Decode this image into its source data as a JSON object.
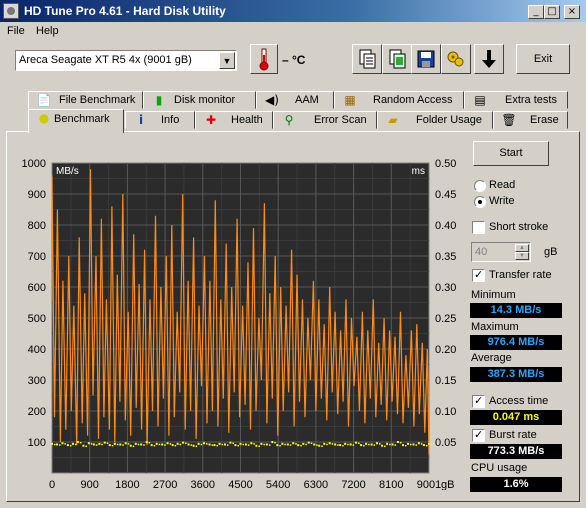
{
  "window": {
    "title": "HD Tune Pro 4.61 - Hard Disk Utility"
  },
  "menu": [
    {
      "label": "File"
    },
    {
      "label": "Help"
    }
  ],
  "toolbar": {
    "drive": "Areca   Seagate XT R5 4x (9001 gB)",
    "temperature": "– °C",
    "exit_label": "Exit",
    "tools": [
      "copy-text-icon",
      "copy-screenshot-icon",
      "save-icon",
      "options-icon",
      "download-icon"
    ]
  },
  "tabs_row1": [
    {
      "label": "File Benchmark",
      "icon": "file-benchmark-icon"
    },
    {
      "label": "Disk monitor",
      "icon": "disk-monitor-icon"
    },
    {
      "label": "AAM",
      "icon": "aam-speaker-icon"
    },
    {
      "label": "Random Access",
      "icon": "random-access-icon"
    },
    {
      "label": "Extra tests",
      "icon": "extra-tests-icon"
    }
  ],
  "tabs_row2": [
    {
      "label": "Benchmark",
      "icon": "benchmark-icon",
      "active": true
    },
    {
      "label": "Info",
      "icon": "info-icon"
    },
    {
      "label": "Health",
      "icon": "health-icon"
    },
    {
      "label": "Error Scan",
      "icon": "error-scan-icon"
    },
    {
      "label": "Folder Usage",
      "icon": "folder-usage-icon"
    },
    {
      "label": "Erase",
      "icon": "erase-icon"
    }
  ],
  "controls": {
    "start_label": "Start",
    "read_label": "Read",
    "write_label": "Write",
    "mode": "Write",
    "short_stroke_label": "Short stroke",
    "short_stroke_checked": false,
    "short_stroke_value": "40",
    "short_stroke_unit": "gB",
    "transfer_rate_label": "Transfer rate",
    "transfer_rate_checked": true,
    "minimum_label": "Minimum",
    "minimum_value": "14.3 MB/s",
    "maximum_label": "Maximum",
    "maximum_value": "976.4 MB/s",
    "average_label": "Average",
    "average_value": "387.3 MB/s",
    "access_time_label": "Access time",
    "access_time_checked": true,
    "access_time_value": "0.047 ms",
    "burst_rate_label": "Burst rate",
    "burst_rate_checked": true,
    "burst_rate_value": "773.3 MB/s",
    "cpu_label": "CPU usage",
    "cpu_value": "1.6%"
  },
  "chart_data": {
    "type": "line",
    "ylabel_left": "MB/s",
    "ylabel_right": "ms",
    "xunit": "gB",
    "xlim": [
      0,
      9001
    ],
    "ylim_left": [
      0,
      1000
    ],
    "ylim_right": [
      0,
      0.5
    ],
    "x_ticks": [
      "0",
      "900",
      "1800",
      "2700",
      "3600",
      "4500",
      "5400",
      "6300",
      "7200",
      "8100",
      "9001"
    ],
    "y_ticks_left": [
      "1000",
      "900",
      "800",
      "700",
      "600",
      "500",
      "400",
      "300",
      "200",
      "100"
    ],
    "y_ticks_right": [
      "0.50",
      "0.45",
      "0.40",
      "0.35",
      "0.30",
      "0.25",
      "0.20",
      "0.15",
      "0.10",
      "0.05"
    ],
    "grid": true,
    "series": [
      {
        "name": "Transfer rate",
        "color": "#ff8c1a",
        "x": [
          0,
          60,
          130,
          200,
          260,
          330,
          400,
          460,
          520,
          590,
          650,
          720,
          780,
          850,
          920,
          980,
          1050,
          1110,
          1180,
          1240,
          1300,
          1370,
          1430,
          1500,
          1560,
          1620,
          1690,
          1750,
          1820,
          1880,
          1950,
          2010,
          2080,
          2140,
          2210,
          2270,
          2340,
          2400,
          2470,
          2530,
          2600,
          2660,
          2730,
          2790,
          2860,
          2920,
          2990,
          3050,
          3120,
          3180,
          3250,
          3310,
          3380,
          3440,
          3510,
          3570,
          3640,
          3700,
          3770,
          3830,
          3900,
          3960,
          4030,
          4090,
          4160,
          4220,
          4290,
          4350,
          4420,
          4480,
          4550,
          4610,
          4680,
          4740,
          4810,
          4870,
          4940,
          5000,
          5070,
          5130,
          5200,
          5260,
          5330,
          5390,
          5460,
          5520,
          5590,
          5650,
          5720,
          5780,
          5850,
          5910,
          5980,
          6040,
          6110,
          6170,
          6240,
          6300,
          6370,
          6430,
          6500,
          6560,
          6630,
          6690,
          6760,
          6820,
          6890,
          6950,
          7020,
          7080,
          7150,
          7210,
          7280,
          7340,
          7410,
          7470,
          7540,
          7600,
          7670,
          7730,
          7800,
          7860,
          7930,
          7990,
          8060,
          8120,
          8190,
          8250,
          8320,
          8380,
          8450,
          8510,
          8580,
          8640,
          8710,
          8770,
          8840,
          8900,
          8960,
          9001
        ],
        "y": [
          960,
          180,
          850,
          100,
          620,
          140,
          700,
          200,
          540,
          90,
          760,
          160,
          580,
          120,
          980,
          250,
          700,
          110,
          820,
          180,
          560,
          140,
          860,
          100,
          640,
          230,
          900,
          170,
          520,
          120,
          770,
          210,
          610,
          140,
          720,
          90,
          560,
          200,
          830,
          150,
          600,
          240,
          700,
          120,
          800,
          180,
          520,
          260,
          900,
          140,
          620,
          200,
          760,
          110,
          540,
          280,
          700,
          160,
          620,
          200,
          880,
          150,
          560,
          240,
          740,
          130,
          600,
          260,
          820,
          180,
          540,
          220,
          680,
          140,
          790,
          200,
          500,
          300,
          870,
          160,
          580,
          240,
          700,
          120,
          600,
          200,
          540,
          260,
          720,
          150,
          640,
          230,
          560,
          180,
          500,
          300,
          620,
          200,
          560,
          240,
          480,
          170,
          600,
          260,
          520,
          190,
          460,
          230,
          560,
          150,
          500,
          280,
          440,
          200,
          520,
          160,
          460,
          240,
          560,
          180,
          420,
          220,
          500,
          170,
          460,
          230,
          440,
          190,
          520,
          160,
          380,
          210,
          460,
          150,
          480,
          190,
          420,
          130,
          400,
          60
        ]
      },
      {
        "name": "Access time",
        "color": "#ffff00",
        "type": "scatter",
        "x": [
          0,
          120,
          250,
          380,
          500,
          620,
          750,
          880,
          1000,
          1130,
          1260,
          1380,
          1500,
          1630,
          1760,
          1880,
          2000,
          2130,
          2260,
          2380,
          2500,
          2630,
          2760,
          2880,
          3000,
          3130,
          3260,
          3380,
          3500,
          3630,
          3760,
          3880,
          4000,
          4130,
          4260,
          4380,
          4500,
          4630,
          4760,
          4880,
          5000,
          5130,
          5260,
          5380,
          5500,
          5630,
          5760,
          5880,
          6000,
          6130,
          6260,
          6380,
          6500,
          6630,
          6760,
          6880,
          7000,
          7130,
          7260,
          7380,
          7500,
          7630,
          7760,
          7880,
          8000,
          8130,
          8260,
          8380,
          8500,
          8630,
          8760,
          8880,
          9000
        ],
        "y": [
          0.047,
          0.046,
          0.048,
          0.045,
          0.047,
          0.05,
          0.044,
          0.048,
          0.046,
          0.047,
          0.049,
          0.045,
          0.047,
          0.046,
          0.048,
          0.044,
          0.047,
          0.046,
          0.05,
          0.045,
          0.047,
          0.046,
          0.048,
          0.045,
          0.047,
          0.049,
          0.046,
          0.044,
          0.047,
          0.048,
          0.046,
          0.045,
          0.047,
          0.046,
          0.049,
          0.045,
          0.047,
          0.046,
          0.048,
          0.044,
          0.047,
          0.046,
          0.05,
          0.045,
          0.047,
          0.046,
          0.048,
          0.045,
          0.047,
          0.049,
          0.046,
          0.044,
          0.047,
          0.048,
          0.046,
          0.045,
          0.047,
          0.046,
          0.049,
          0.045,
          0.047,
          0.046,
          0.048,
          0.044,
          0.047,
          0.046,
          0.05,
          0.045,
          0.047,
          0.046,
          0.048,
          0.045,
          0.047
        ]
      }
    ]
  }
}
